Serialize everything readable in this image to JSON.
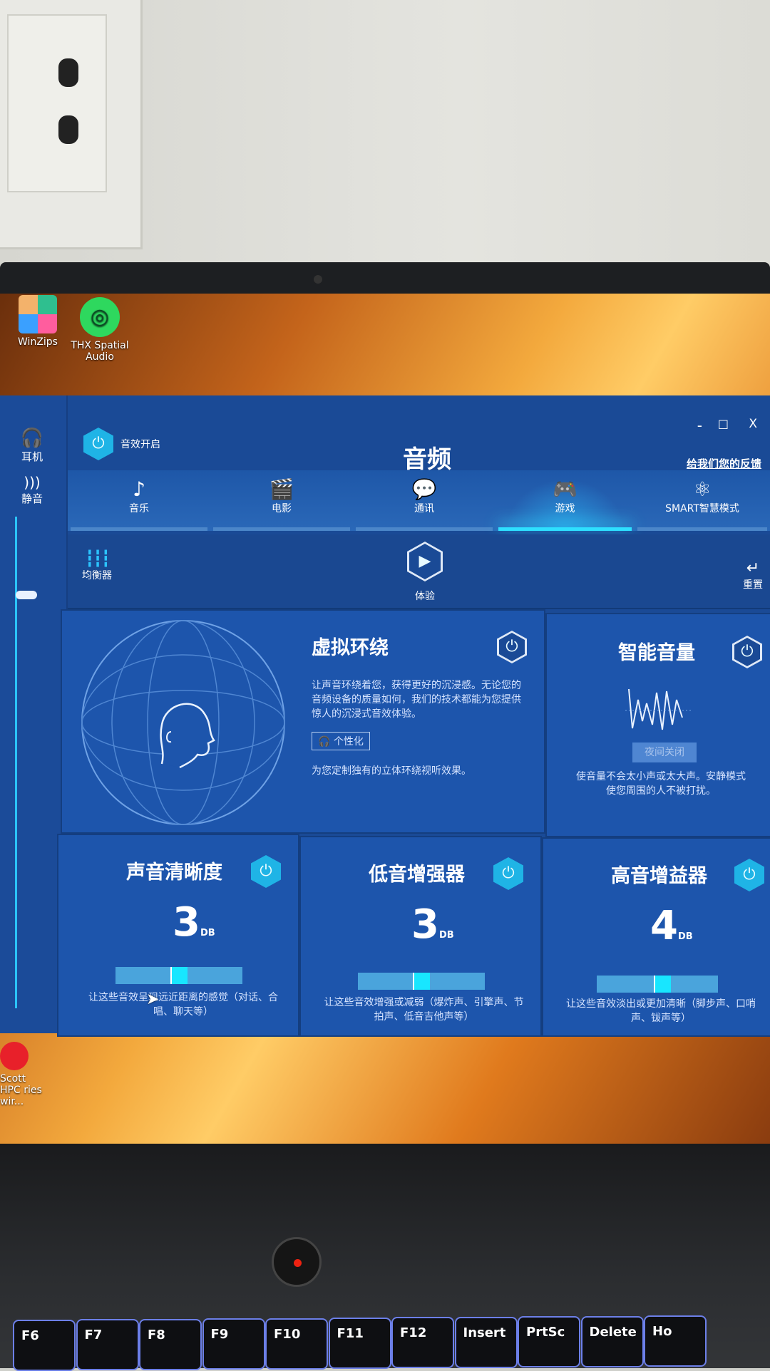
{
  "desktop": {
    "icons": [
      {
        "label": "WinZips"
      },
      {
        "label": "THX Spatial Audio"
      },
      {
        "label": "Scott HPC ries wir..."
      }
    ]
  },
  "window": {
    "minimize": "-",
    "maximize": "□",
    "close": "X"
  },
  "sidebar": {
    "headphones": "耳机",
    "mute": "静音",
    "volume_level": 0.85
  },
  "header": {
    "effects_toggle": "音效开启",
    "title": "音频",
    "feedback": "给我们您的反馈"
  },
  "tabs": [
    {
      "label": "音乐",
      "icon": "music-note-icon",
      "glyph": "♪"
    },
    {
      "label": "电影",
      "icon": "clapperboard-icon",
      "glyph": "🎬"
    },
    {
      "label": "通讯",
      "icon": "chat-icon",
      "glyph": "💬"
    },
    {
      "label": "游戏",
      "icon": "gamepad-icon",
      "glyph": "🎮",
      "active": true
    },
    {
      "label": "SMART智慧模式",
      "icon": "atom-icon",
      "glyph": "⚛"
    }
  ],
  "toolbar": {
    "equalizer": "均衡器",
    "experience": "体验",
    "reset": "重置"
  },
  "virtual_surround": {
    "title": "虚拟环绕",
    "description": "让声音环绕着您，获得更好的沉浸感。无论您的音频设备的质量如何，我们的技术都能为您提供惊人的沉浸式音效体验。",
    "personalize": "个性化",
    "footer": "为您定制独有的立体环绕视听效果。"
  },
  "smart_volume": {
    "title": "智能音量",
    "night_button": "夜间关闭",
    "description": "使音量不会太小声或太大声。安静模式使您周围的人不被打扰。"
  },
  "effects": [
    {
      "title": "声音清晰度",
      "value": "3",
      "unit": "DB",
      "level": 0.5,
      "description": "让这些音效呈现远近距离的感觉（对话、合唱、聊天等）"
    },
    {
      "title": "低音增强器",
      "value": "3",
      "unit": "DB",
      "level": 0.5,
      "description": "让这些音效增强或减弱（爆炸声、引擎声、节拍声、低音吉他声等）"
    },
    {
      "title": "高音增益器",
      "value": "4",
      "unit": "DB",
      "level": 0.55,
      "description": "让这些音效淡出或更加清晰（脚步声、口哨声、钹声等）"
    }
  ],
  "keyboard": [
    "F6",
    "F7",
    "F8",
    "F9",
    "F10",
    "F11",
    "F12",
    "Insert",
    "PrtSc",
    "Delete",
    "Ho"
  ],
  "colors": {
    "accent": "#1fb4e6",
    "panel": "#1d55ac",
    "active_tab": "#2ee0ff"
  }
}
